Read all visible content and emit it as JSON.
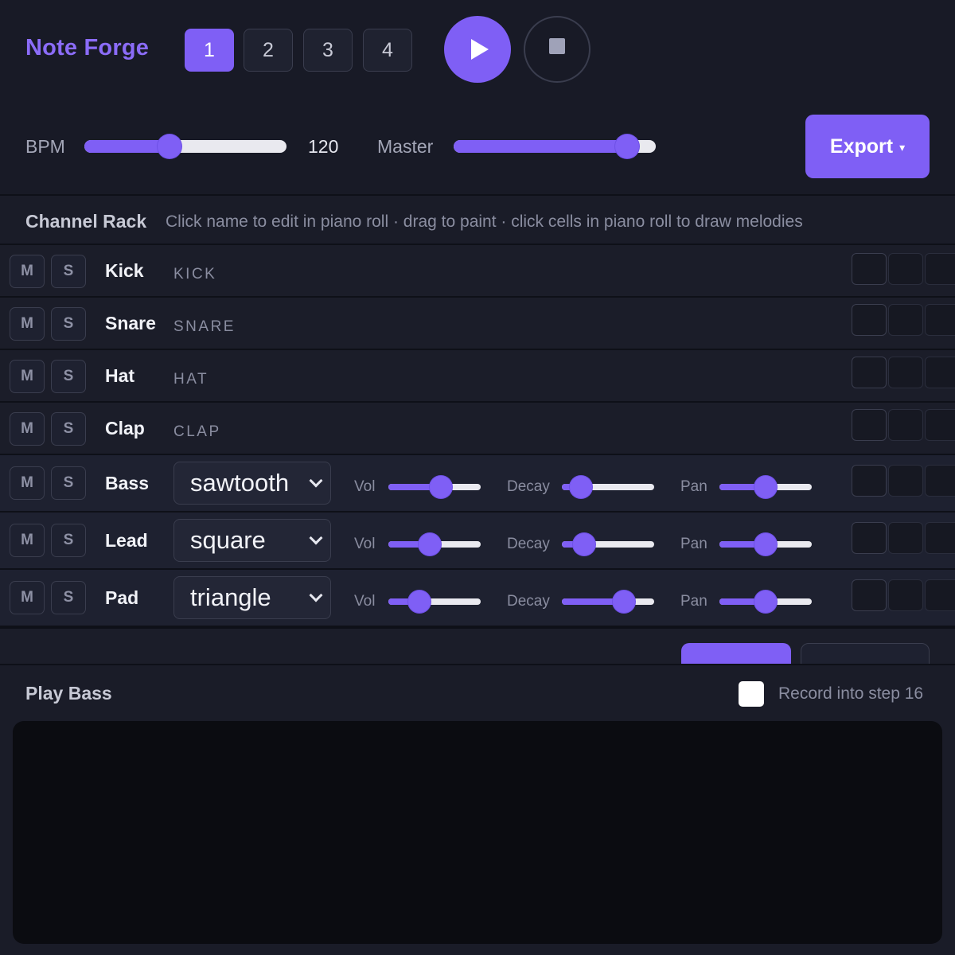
{
  "app": {
    "title": "Note Forge"
  },
  "patterns": [
    "1",
    "2",
    "3",
    "4"
  ],
  "active_pattern": "1",
  "transport": {
    "play_icon": "play-icon",
    "stop_icon": "stop-icon"
  },
  "bpm": {
    "label": "BPM",
    "value": "120",
    "level": 0.42
  },
  "master": {
    "label": "Master",
    "level": 0.86
  },
  "export": {
    "label": "Export",
    "caret": "▾"
  },
  "channel_rack": {
    "title": "Channel Rack",
    "hint": "Click name to edit in piano roll · drag to paint · click cells in piano roll to draw melodies",
    "mute_label": "M",
    "solo_label": "S",
    "channels": [
      {
        "name": "Kick",
        "tag": "KICK"
      },
      {
        "name": "Snare",
        "tag": "SNARE"
      },
      {
        "name": "Hat",
        "tag": "HAT"
      },
      {
        "name": "Clap",
        "tag": "CLAP"
      },
      {
        "name": "Bass",
        "wave": "sawtooth",
        "vol": 0.57,
        "decay": 0.21,
        "pan": 0.5
      },
      {
        "name": "Lead",
        "wave": "square",
        "vol": 0.45,
        "decay": 0.24,
        "pan": 0.5
      },
      {
        "name": "Pad",
        "wave": "triangle",
        "vol": 0.34,
        "decay": 0.67,
        "pan": 0.5
      }
    ],
    "param_labels": {
      "vol": "Vol",
      "decay": "Decay",
      "pan": "Pan"
    }
  },
  "play_panel": {
    "title": "Play Bass",
    "record_label": "Record into step 16"
  },
  "colors": {
    "accent": "#7f5ff5",
    "background": "#181a26",
    "panel": "#1e2130"
  }
}
